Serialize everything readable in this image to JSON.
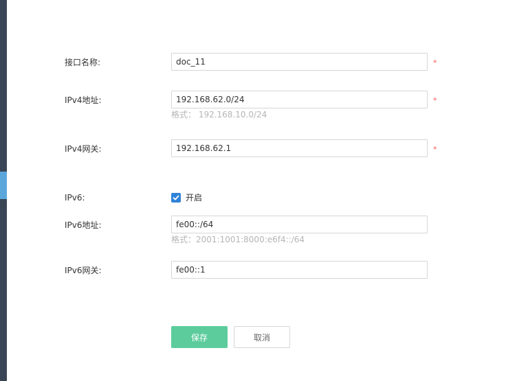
{
  "form": {
    "interface_name": {
      "label": "接口名称:",
      "value": "doc_11",
      "required_mark": "*"
    },
    "ipv4_address": {
      "label": "IPv4地址:",
      "value": "192.168.62.0/24",
      "required_mark": "*",
      "hint": "格式： 192.168.10.0/24"
    },
    "ipv4_gateway": {
      "label": "IPv4网关:",
      "value": "192.168.62.1",
      "required_mark": "*"
    },
    "ipv6": {
      "label": "IPv6:",
      "checkbox_checked": true,
      "checkbox_label": "开启"
    },
    "ipv6_address": {
      "label": "IPv6地址:",
      "value": "fe00::/64",
      "hint": "格式：2001:1001:8000:e6f4::/64"
    },
    "ipv6_gateway": {
      "label": "IPv6网关:",
      "value": "fe00::1"
    }
  },
  "actions": {
    "save_label": "保存",
    "cancel_label": "取消"
  },
  "colors": {
    "sidebar_bg": "#3a4555",
    "sidebar_accent": "#5ba7dc",
    "required": "#f05a5a",
    "checkbox": "#2f82d8",
    "primary_button": "#5ccc9c",
    "hint_text": "#b5b5b5"
  },
  "icons": {
    "checkbox": "checkmark-icon"
  }
}
